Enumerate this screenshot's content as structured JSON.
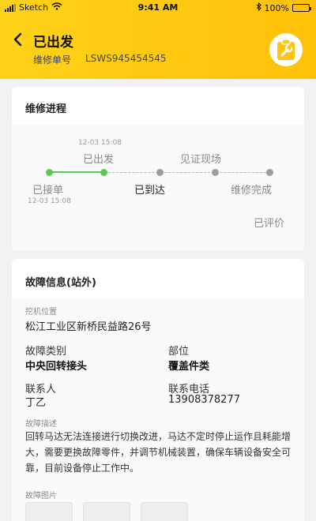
{
  "status_bar": {
    "carrier": "Sketch",
    "time": "9:41 AM",
    "battery": "100%"
  },
  "header": {
    "title": "已出发",
    "order_label": "维修单号",
    "order_no": "LSWS945454545"
  },
  "progress": {
    "title": "维修进程",
    "steps": [
      {
        "label": "已接单",
        "time": "12-03 15:08"
      },
      {
        "label": "已出发",
        "time": "12-03 15:08"
      },
      {
        "label": "已到达"
      },
      {
        "label": "见证现场"
      },
      {
        "label": "维修完成"
      }
    ],
    "review_status": "已评价"
  },
  "fault": {
    "title": "故障信息(站外)",
    "location_label": "挖机位置",
    "location_value": "松江工业区新桥民益路26号",
    "category_label": "故障类别",
    "category_value": "中央回转接头",
    "part_label": "部位",
    "part_value": "覆盖件类",
    "contact_label": "联系人",
    "contact_value": "丁乙",
    "phone_label": "联系电话",
    "phone_value": "13908378277",
    "desc_label": "故障描述",
    "desc_value": "回转马达无法连接进行切换改进，马达不定时停止运作且耗能增大，需要更换故障零件，并调节机械装置，确保车辆设备安全可靠，目前设备停止工作中。",
    "images_label": "故障图片"
  },
  "colors": {
    "accent": "#ffcc00",
    "progress_done": "#5ac94f",
    "progress_todo": "#9e9e9e"
  }
}
